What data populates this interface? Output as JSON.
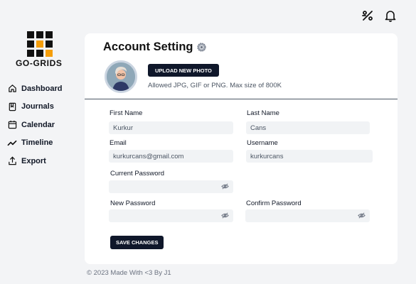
{
  "app": {
    "name": "GO-GRIDS"
  },
  "header": {
    "icons": [
      "percent-icon",
      "bell-icon"
    ]
  },
  "sidebar": {
    "items": [
      {
        "label": "Dashboard",
        "icon": "home-icon"
      },
      {
        "label": "Journals",
        "icon": "book-icon"
      },
      {
        "label": "Calendar",
        "icon": "calendar-icon"
      },
      {
        "label": "Timeline",
        "icon": "trend-icon"
      },
      {
        "label": "Export",
        "icon": "export-icon"
      }
    ]
  },
  "account": {
    "title": "Account Setting",
    "upload_label": "UPLOAD NEW PHOTO",
    "upload_hint": "Allowed JPG, GIF or PNG. Max size of 800K",
    "fields": {
      "first_name": {
        "label": "First Name",
        "value": "Kurkur"
      },
      "last_name": {
        "label": "Last Name",
        "value": "Cans"
      },
      "email": {
        "label": "Email",
        "value": "kurkurcans@gmail.com"
      },
      "username": {
        "label": "Username",
        "value": "kurkurcans"
      },
      "current_password": {
        "label": "Current Password",
        "value": ""
      },
      "new_password": {
        "label": "New Password",
        "value": ""
      },
      "confirm_password": {
        "label": "Confirm Password",
        "value": ""
      }
    },
    "save_label": "SAVE CHANGES"
  },
  "footer": {
    "text": "© 2023 Made With <3 By J1"
  },
  "colors": {
    "accent": "#f59e0b",
    "dark": "#0f172a",
    "background": "#f3f4f6"
  }
}
